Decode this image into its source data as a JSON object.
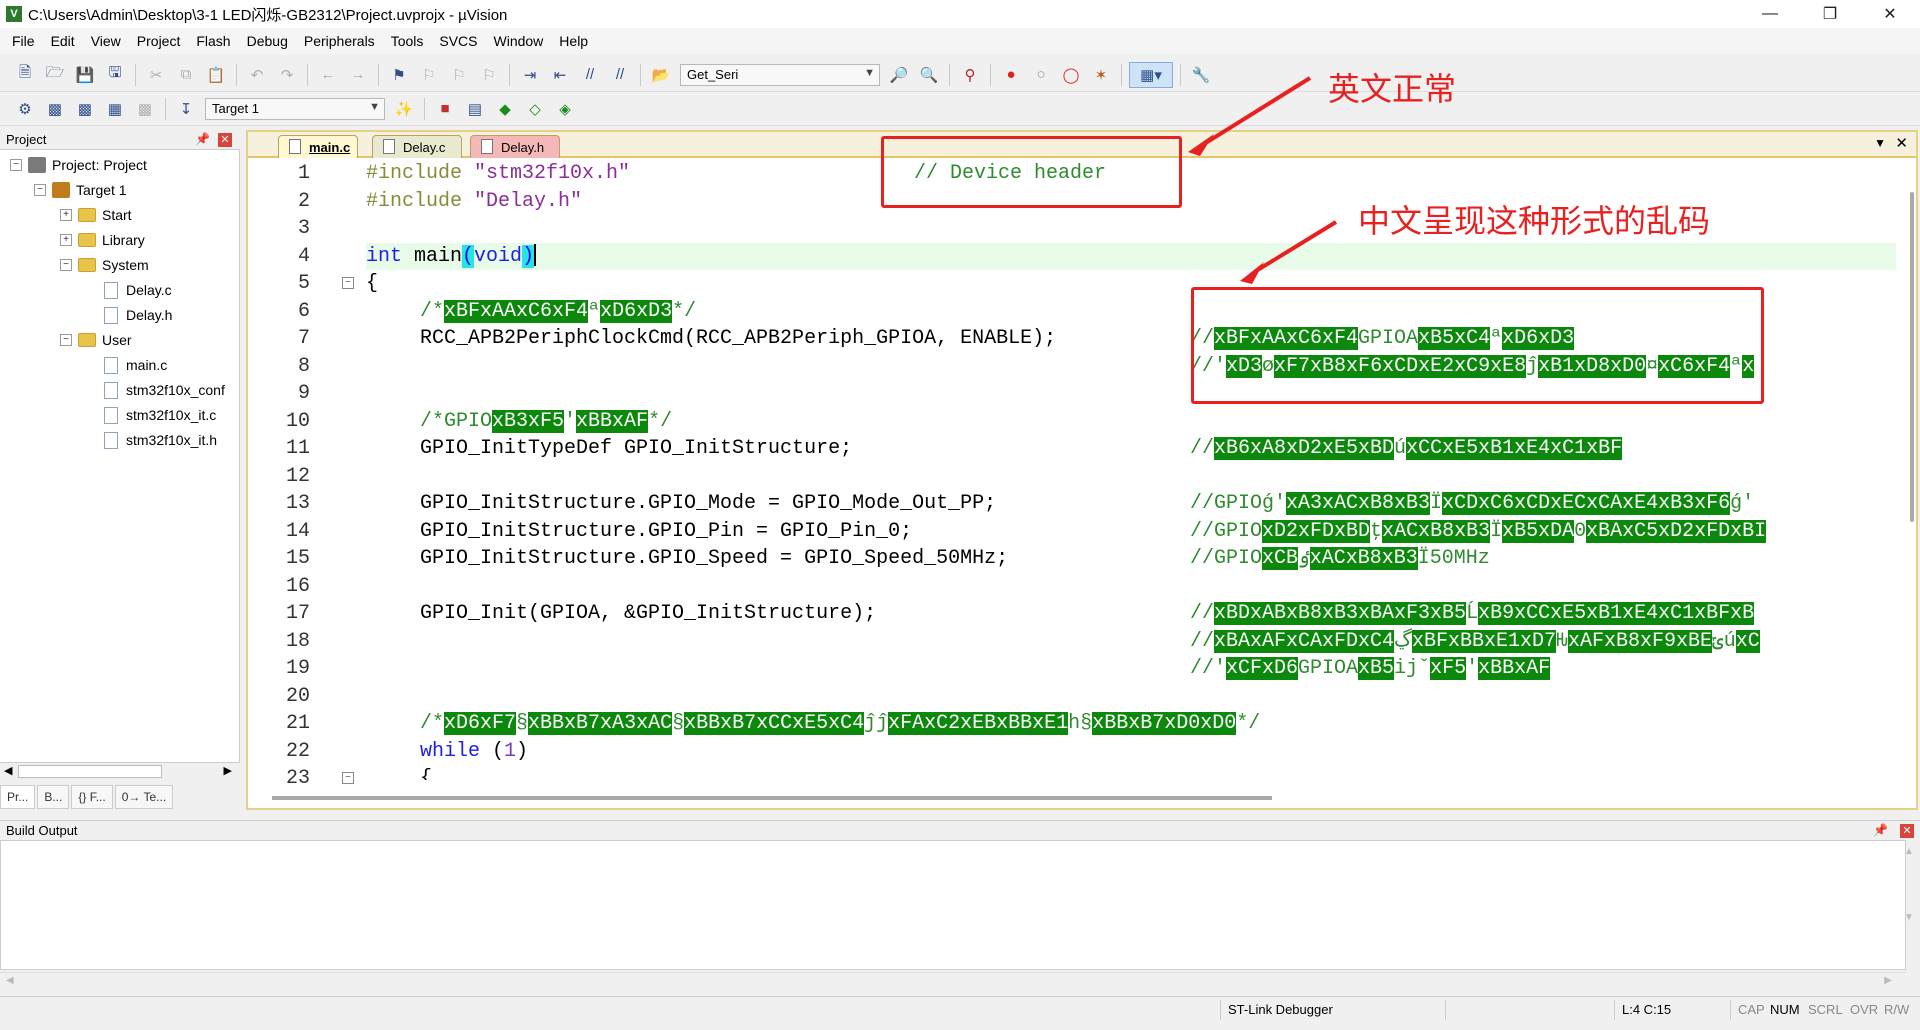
{
  "window": {
    "title": "C:\\Users\\Admin\\Desktop\\3-1 LED闪烁-GB2312\\Project.uvprojx - µVision"
  },
  "menu": [
    "File",
    "Edit",
    "View",
    "Project",
    "Flash",
    "Debug",
    "Peripherals",
    "Tools",
    "SVCS",
    "Window",
    "Help"
  ],
  "toolbar": {
    "find_combo": "Get_Seri",
    "target_combo": "Target 1"
  },
  "project": {
    "title": "Project",
    "tree": [
      "Project: Project",
      "Target 1",
      "Start",
      "Library",
      "System",
      "Delay.c",
      "Delay.h",
      "User",
      "main.c",
      "stm32f10x_conf",
      "stm32f10x_it.c",
      "stm32f10x_it.h"
    ],
    "bottom_tabs": [
      "Pr...",
      "B...",
      "{} F...",
      "0→ Te..."
    ]
  },
  "editor": {
    "tabs": [
      "main.c",
      "Delay.c",
      "Delay.h"
    ],
    "line_numbers": [
      "1",
      "2",
      "3",
      "4",
      "5",
      "6",
      "7",
      "8",
      "9",
      "10",
      "11",
      "12",
      "13",
      "14",
      "15",
      "16",
      "17",
      "18",
      "19",
      "20",
      "21",
      "22",
      "23"
    ],
    "code": {
      "l1a": "#include ",
      "l1b": "\"stm32f10x.h\"",
      "l2a": "#include ",
      "l2b": "\"Delay.h\"",
      "l4a": "int",
      "l4b": " main",
      "l4c": "(",
      "l4d": "void",
      "l4e": ")",
      "l5": "{",
      "l6a": "/*",
      "l6b": "xBFxAAxC6xF4",
      "l6c": "ª",
      "l6d": "xD6xD3",
      "l6e": "*/",
      "l7": "RCC_APB2PeriphClockCmd(RCC_APB2Periph_GPIOA, ENABLE);",
      "l10a": "/*GPIO",
      "l10b": "xB3xF5",
      "l10c": "'",
      "l10d": "xBBxAF",
      "l10e": "*/",
      "l11": "GPIO_InitTypeDef GPIO_InitStructure;",
      "l13": "GPIO_InitStructure.GPIO_Mode = GPIO_Mode_Out_PP;",
      "l14": "GPIO_InitStructure.GPIO_Pin = GPIO_Pin_0;",
      "l15": "GPIO_InitStructure.GPIO_Speed = GPIO_Speed_50MHz;",
      "l17": "GPIO_Init(GPIOA, &GPIO_InitStructure);",
      "l21a": "/*",
      "l21b": "xD6xF7",
      "l21c": "§",
      "l21d": "xBBxB7xA3xAC",
      "l21e": "§",
      "l21f": "xBBxB7xCCxE5xC4",
      "l21g": "ĵĵ",
      "l21h": "xFAxC2xEBxBBxE1",
      "l21i": "h§",
      "l21j": "xBBxB7xD0xD0",
      "l21k": "*/",
      "l22a": "while",
      "l22b": " (",
      "l22c": "1",
      "l22d": ")",
      "l23": "{"
    },
    "comments": {
      "c1": "// Device header",
      "c7a": "//",
      "c7b": "xBFxAAxC6xF4",
      "c7c": "GPIOA",
      "c7d": "xB5xC4",
      "c7e": "ª",
      "c7f": "xD6xD3",
      "c8a": "//'",
      "c8b": "xD3",
      "c8c": "ø",
      "c8d": "xF7xB8xF6xCDxE2xC9xE8",
      "c8e": "ĵ",
      "c8f": "xB1xD8xD0",
      "c8g": "¤",
      "c8h": "xC6xF4",
      "c8i": "ª",
      "c8j": "x",
      "c11a": "//",
      "c11b": "xB6xA8xD2xE5xBD",
      "c11c": "ú",
      "c11d": "xCCxE5xB1xE4xC1xBF",
      "c13a": "//GPIOǵ'",
      "c13b": "xA3xACxB8xB3",
      "c13c": "Ï",
      "c13d": "xCDxC6xCDxECxCAxE4xB3xF6",
      "c13e": "ǵ'",
      "c14a": "//GPIO",
      "c14b": "xD2xFDxBD",
      "c14c": "ţ",
      "c14d": "xACxB8xB3",
      "c14e": "Ï",
      "c14f": "xB5xDA",
      "c14g": "0",
      "c14h": "xBAxC5xD2xFDxBI",
      "c15a": "//GPIO",
      "c15b": "xCB",
      "c15c": "ٶ",
      "c15d": "xACxB8xB3",
      "c15e": "Ï50MHz",
      "c17a": "//",
      "c17b": "xBDxABxB8xB3xBAxF3xB5",
      "c17c": "Ĺ",
      "c17d": "xB9xCCxE5xB1xE4xC1xBFxB",
      "c18a": "//",
      "c18b": "xBAxAFxCAxFDxC4",
      "c18c": "ڲ",
      "c18d": "xBFxBBxE1xD7",
      "c18e": "Ԋ",
      "c18f": "xAFxB8xF9xBE",
      "c18g": "ݶú",
      "c18h": "xC",
      "c19a": "//ʹ",
      "c19b": "xCFxD6",
      "c19c": "GPIOA",
      "c19d": "xB5",
      "c19e": "ijˇ",
      "c19f": "xF5",
      "c19g": "'",
      "c19h": "xBBxAF"
    }
  },
  "annotations": {
    "english_ok": "英文正常",
    "chinese_garbled": "中文呈现这种形式的乱码"
  },
  "build": {
    "title": "Build Output"
  },
  "status": {
    "debugger": "ST-Link Debugger",
    "position": "L:4 C:15",
    "cap": "CAP",
    "num": "NUM",
    "scrl": "SCRL",
    "ovr": "OVR",
    "rw": "R/W"
  }
}
